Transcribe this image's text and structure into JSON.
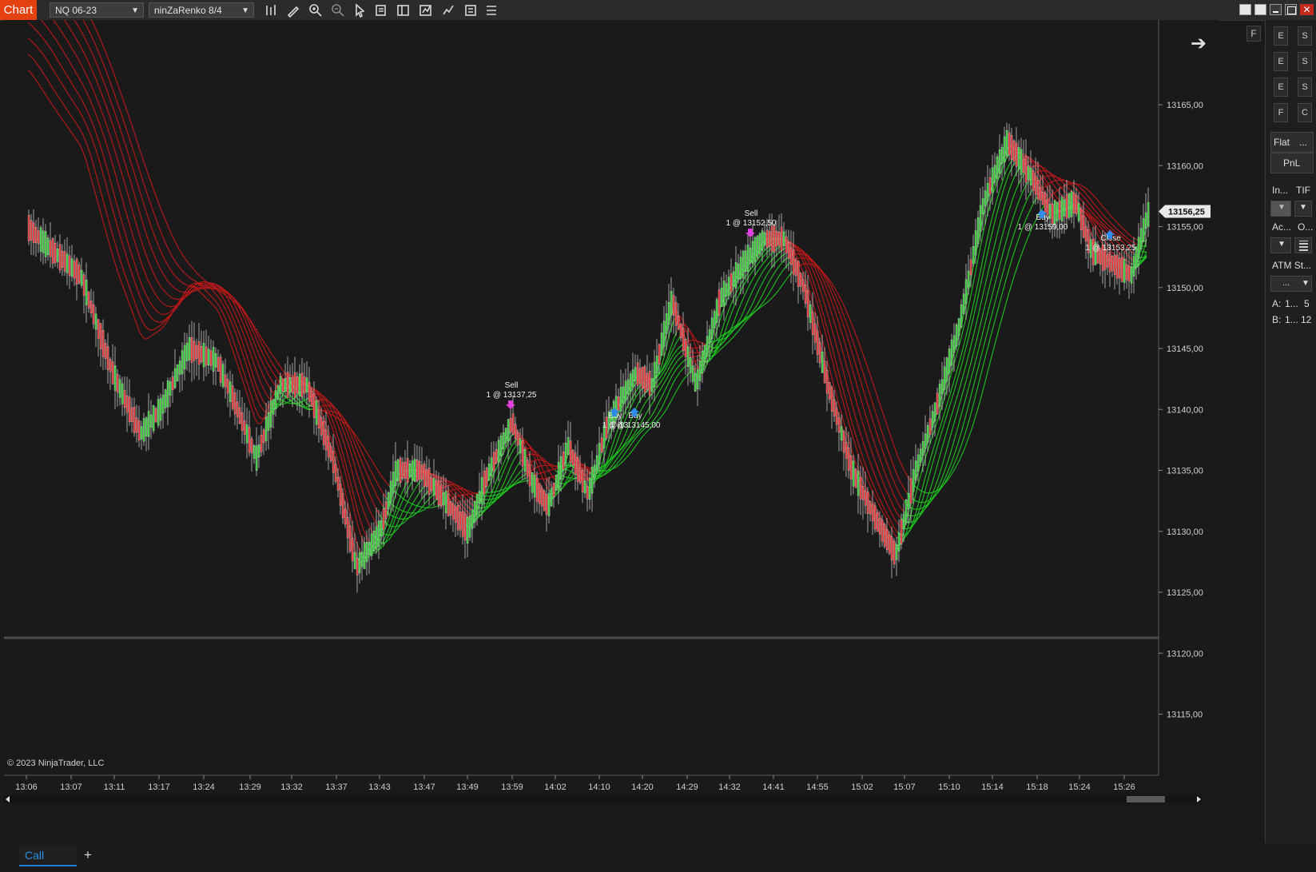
{
  "app": {
    "tab_label": "Chart"
  },
  "toolbar": {
    "instrument": "NQ 06-23",
    "bar_type": "ninZaRenko 8/4",
    "icons": [
      "bar-style-icon",
      "pencil-icon",
      "zoom-in-icon",
      "zoom-out-icon",
      "pointer-icon",
      "data-box-icon",
      "layout-icon",
      "indicators-icon",
      "strategies-icon",
      "properties-icon",
      "menu-icon"
    ]
  },
  "drawing_tools": [
    "ruler-icon",
    "risk-reward-icon",
    "line-icon",
    "ray-icon",
    "extended-line-icon",
    "arrow-line-icon",
    "vertical-line-icon",
    "horizontal-lines-icon",
    "fibonacci-icon",
    "ellipse-icon",
    "rectangle-icon",
    "regression-icon",
    "region-icon",
    "arrow-up-icon",
    "arrow-down-icon",
    "circle-icon",
    "triangle-up-icon",
    "triangle-down-icon",
    "pencil-draw-icon"
  ],
  "chart": {
    "copyright": "© 2023 NinjaTrader, LLC",
    "price_axis": [
      "13165,00",
      "13160,00",
      "13155,00",
      "13150,00",
      "13145,00",
      "13140,00",
      "13135,00",
      "13130,00",
      "13125,00",
      "13120,00",
      "13115,00"
    ],
    "current_price": "13156,25",
    "time_axis": [
      "13:06",
      "13:07",
      "13:11",
      "13:17",
      "13:24",
      "13:29",
      "13:32",
      "13:37",
      "13:43",
      "13:47",
      "13:49",
      "13:59",
      "14:02",
      "14:10",
      "14:20",
      "14:29",
      "14:32",
      "14:41",
      "14:55",
      "15:02",
      "15:07",
      "15:10",
      "15:14",
      "15:18",
      "15:24",
      "15:26"
    ],
    "annotations": [
      {
        "line1": "Sell",
        "line2": "1 @ 13137,25"
      },
      {
        "line1": "Sell",
        "line2": "1 @ 13152,50"
      },
      {
        "line1": "Buy",
        "line2": "1 @ 13"
      },
      {
        "line1": "Buy",
        "line2": "1 @ 13145,00"
      },
      {
        "line1": "Buy",
        "line2": "1 @ 13159,00"
      },
      {
        "line1": "Close",
        "line2": "1 @ 13153,25"
      }
    ],
    "colors": {
      "bg": "#1a1a1a",
      "up": "#3ec93e",
      "down": "#e03c3c",
      "ribbon_up": "#1ec81e",
      "ribbon_down": "#c01818"
    },
    "scroll_arrows": [
      "scroll-left-icon",
      "scroll-right-icon"
    ]
  },
  "right_panel": {
    "buttons_left": [
      "E",
      "E",
      "E",
      "F"
    ],
    "buttons_right": [
      "S",
      "S",
      "S",
      "C"
    ],
    "flat": "Flat",
    "flat_more": "...",
    "pnl": "PnL",
    "instrument_short": "In...",
    "tif": "TIF",
    "account_short": "Ac...",
    "o_short": "O...",
    "atm": "ATM St...",
    "atm_value": "...",
    "ask_label": "A:",
    "ask_value": "1...",
    "ask_size": "5",
    "bid_label": "B:",
    "bid_value": "1...",
    "bid_size": "12"
  },
  "tabs": [
    {
      "label": "Call"
    }
  ],
  "add_tab": "+"
}
